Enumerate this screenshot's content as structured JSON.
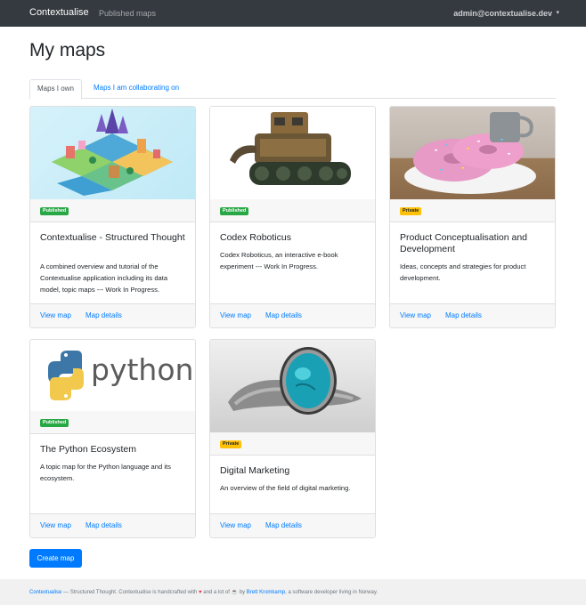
{
  "navbar": {
    "brand": "Contextualise",
    "published_maps": "Published maps",
    "user": "admin@contextualise.dev",
    "caret": "▾"
  },
  "page": {
    "title": "My maps"
  },
  "tabs": [
    {
      "label": "Maps I own",
      "active": true
    },
    {
      "label": "Maps I am collaborating on",
      "active": false
    }
  ],
  "cards": [
    {
      "badge": "Published",
      "title": "Contextualise - Structured Thought",
      "description": "A combined overview and tutorial of the Contextualise application including its data model, topic maps --- Work In Progress.",
      "view_label": "View map",
      "details_label": "Map details"
    },
    {
      "badge": "Published",
      "title": "Codex Roboticus",
      "description": "Codex Roboticus, an interactive e-book experiment --- Work In Progress.",
      "view_label": "View map",
      "details_label": "Map details"
    },
    {
      "badge": "Private",
      "title": "Product Conceptualisation and Development",
      "description": "Ideas, concepts and strategies for product development.",
      "view_label": "View map",
      "details_label": "Map details"
    },
    {
      "badge": "Published",
      "title": "The Python Ecosystem",
      "description": "A topic map for the Python language and its ecosystem.",
      "view_label": "View map",
      "details_label": "Map details",
      "logo_text": "python"
    },
    {
      "badge": "Private",
      "title": "Digital Marketing",
      "description": "An overview of the field of digital marketing.",
      "view_label": "View map",
      "details_label": "Map details"
    }
  ],
  "create_button": "Create map",
  "footer": {
    "brand_link": "Contextualise",
    "text1": " — Structured Thought. Contextualise is handcrafted with ",
    "heart": "♥",
    "text2": " and a lot of ",
    "coffee": "☕",
    "text3": " by ",
    "author_link": "Brett Kromkamp",
    "text4": ", a software developer living in Norway."
  },
  "colors": {
    "navbar": "#343a40",
    "link": "#007bff",
    "published": "#28a745",
    "private": "#ffc107"
  }
}
